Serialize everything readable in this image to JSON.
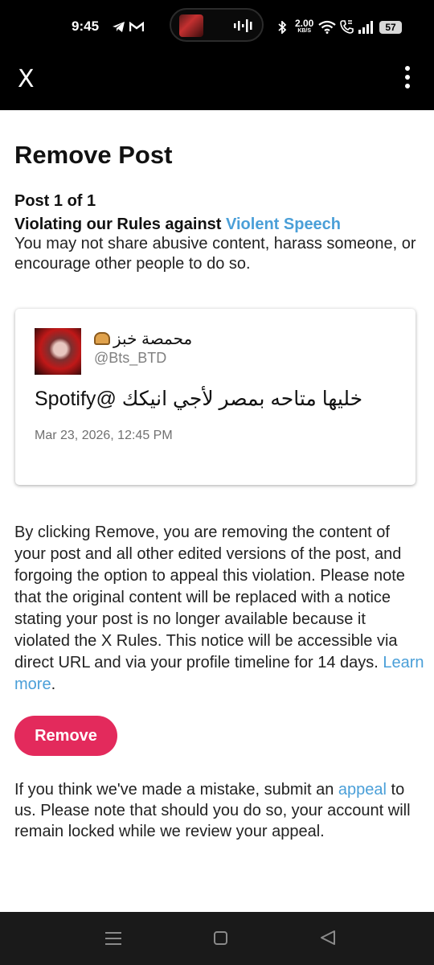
{
  "status_bar": {
    "time": "9:45",
    "speed_value": "2.00",
    "speed_unit": "KB/S",
    "battery": "57",
    "icons": [
      "telegram-icon",
      "gmail-icon",
      "bluetooth-icon",
      "wifi-icon",
      "call-icon",
      "signal-icon",
      "battery-icon"
    ]
  },
  "app_bar": {
    "close_label": "X",
    "menu_icon": "more-vertical-icon"
  },
  "page": {
    "title": "Remove Post",
    "post_count": "Post 1 of 1",
    "rule_prefix": "Violating our Rules against ",
    "rule_link": "Violent Speech",
    "rule_description": "You may not share abusive content, harass someone, or encourage other people to do so."
  },
  "post_card": {
    "display_name": "محمصة خبز",
    "handle": "@Bts_BTD",
    "text": "خليها متاحه بمصر لأجي انيكك @Spotify",
    "date": "Mar 23, 2026, 12:45 PM"
  },
  "notice": {
    "text": "By clicking Remove, you are removing the content of your post and all other edited versions of the post, and forgoing the option to appeal this violation. Please note that the original content will be replaced with a notice stating your post is no longer available because it violated the X Rules. This notice will be accessible via direct URL and via your profile timeline for 14 days. ",
    "link": "Learn more",
    "suffix": "."
  },
  "remove_button": {
    "label": "Remove",
    "color": "#e32a5c"
  },
  "appeal": {
    "prefix": "If you think we've made a mistake, submit an ",
    "link": "appeal",
    "suffix": " to us. Please note that should you do so, your account will remain locked while we review your appeal."
  },
  "colors": {
    "link": "#4a9fd8",
    "header_bg": "#000000",
    "nav_bg": "#1a1a1a"
  }
}
